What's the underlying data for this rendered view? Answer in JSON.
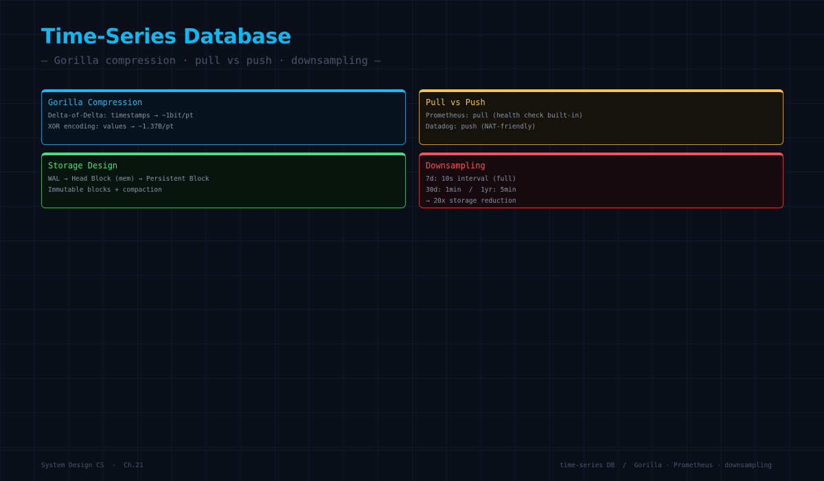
{
  "header": {
    "title": "Time-Series Database",
    "subtitle": "— Gorilla compression · pull vs push · downsampling —"
  },
  "cards": [
    {
      "title": "Gorilla Compression",
      "accent": "#22b8f0",
      "border": "#1f8fc4",
      "background": "#07141f",
      "lines": [
        "Delta-of-Delta: timestamps → ~1bit/pt",
        "XOR encoding: values → ~1.37B/pt"
      ]
    },
    {
      "title": "Pull vs Push",
      "accent": "#f5c451",
      "border": "#c99a2e",
      "background": "#15130b",
      "lines": [
        "Prometheus: pull (health check built-in)",
        "Datadog: push (NAT-friendly)"
      ]
    },
    {
      "title": "Storage Design",
      "accent": "#4ade80",
      "border": "#3aa566",
      "background": "#08150f",
      "lines": [
        "WAL → Head Block (mem) → Persistent Block",
        "Immutable blocks + compaction"
      ]
    },
    {
      "title": "Downsampling",
      "accent": "#f0555a",
      "border": "#b8393f",
      "background": "#170b10",
      "lines": [
        "7d: 10s interval (full)",
        "30d: 1min  /  1yr: 5min",
        "→ 20x storage reduction"
      ]
    }
  ],
  "footer": {
    "left": "System Design CS  ·  Ch.21",
    "right": "time-series DB  /  Gorilla · Prometheus · downsampling"
  }
}
